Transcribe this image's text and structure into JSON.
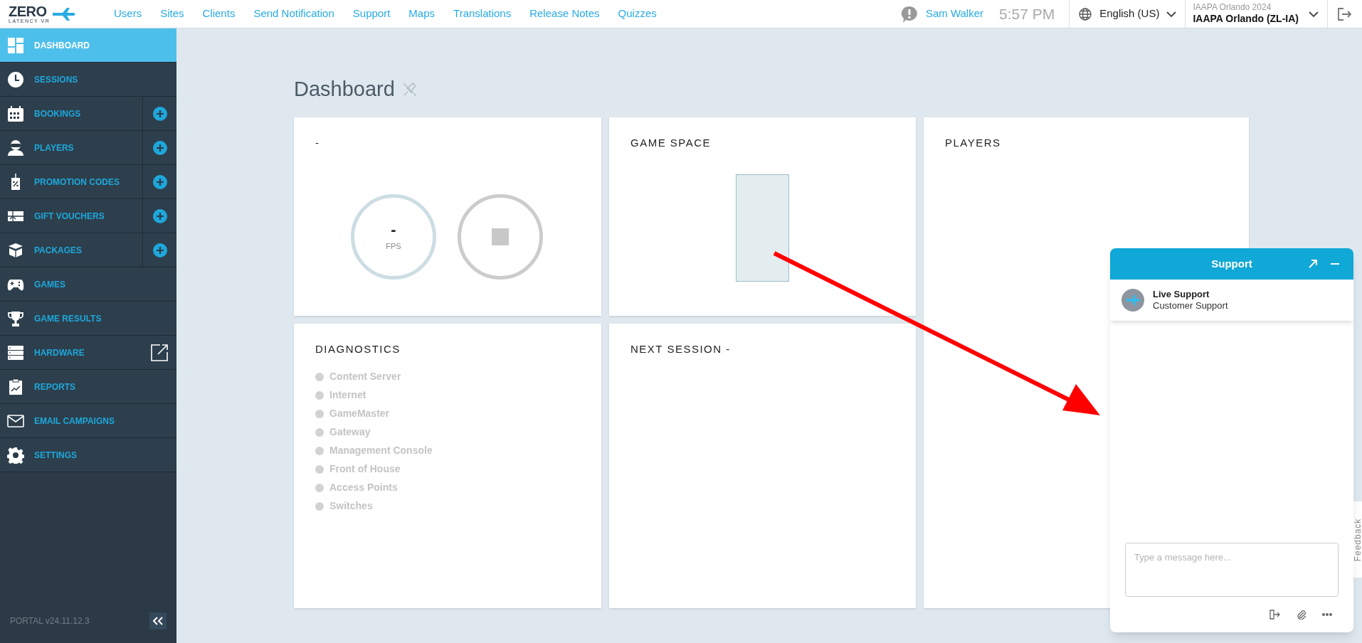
{
  "header": {
    "logo": {
      "word": "ZERO",
      "tagline": "LATENCY VR"
    },
    "nav": [
      {
        "label": "Users"
      },
      {
        "label": "Sites"
      },
      {
        "label": "Clients"
      },
      {
        "label": "Send Notification"
      },
      {
        "label": "Support"
      },
      {
        "label": "Maps"
      },
      {
        "label": "Translations"
      },
      {
        "label": "Release Notes"
      },
      {
        "label": "Quizzes"
      }
    ],
    "user": "Sam Walker",
    "time": "5:57 PM",
    "language": "English (US)",
    "site": {
      "event": "IAAPA Orlando 2024",
      "name": "IAAPA Orlando (ZL-IA)"
    }
  },
  "sidebar": {
    "items": [
      {
        "label": "DASHBOARD",
        "selected": true,
        "kind": "plain"
      },
      {
        "label": "SESSIONS",
        "selected": false,
        "kind": "plain"
      },
      {
        "label": "BOOKINGS",
        "selected": false,
        "kind": "add"
      },
      {
        "label": "PLAYERS",
        "selected": false,
        "kind": "add"
      },
      {
        "label": "PROMOTION CODES",
        "selected": false,
        "kind": "add"
      },
      {
        "label": "GIFT VOUCHERS",
        "selected": false,
        "kind": "add"
      },
      {
        "label": "PACKAGES",
        "selected": false,
        "kind": "add"
      },
      {
        "label": "GAMES",
        "selected": false,
        "kind": "plain"
      },
      {
        "label": "GAME RESULTS",
        "selected": false,
        "kind": "plain"
      },
      {
        "label": "HARDWARE",
        "selected": false,
        "kind": "external"
      },
      {
        "label": "REPORTS",
        "selected": false,
        "kind": "plain"
      },
      {
        "label": "EMAIL CAMPAIGNS",
        "selected": false,
        "kind": "plain"
      },
      {
        "label": "SETTINGS",
        "selected": false,
        "kind": "plain"
      }
    ],
    "version": "PORTAL v24.11.12.3"
  },
  "page": {
    "title": "Dashboard"
  },
  "cards": {
    "status": {
      "title": "-",
      "fps_value": "-",
      "fps_label": "FPS"
    },
    "game_space": {
      "title": "GAME SPACE"
    },
    "players": {
      "title": "PLAYERS"
    },
    "diagnostics": {
      "title": "DIAGNOSTICS",
      "items": [
        "Content Server",
        "Internet",
        "GameMaster",
        "Gateway",
        "Management Console",
        "Front of House",
        "Access Points",
        "Switches"
      ]
    },
    "next_session": {
      "title": "NEXT SESSION -"
    }
  },
  "chat": {
    "title": "Support",
    "agent": "Live Support",
    "team": "Customer Support",
    "placeholder": "Type a message here..."
  },
  "feedback": "Feedback"
}
